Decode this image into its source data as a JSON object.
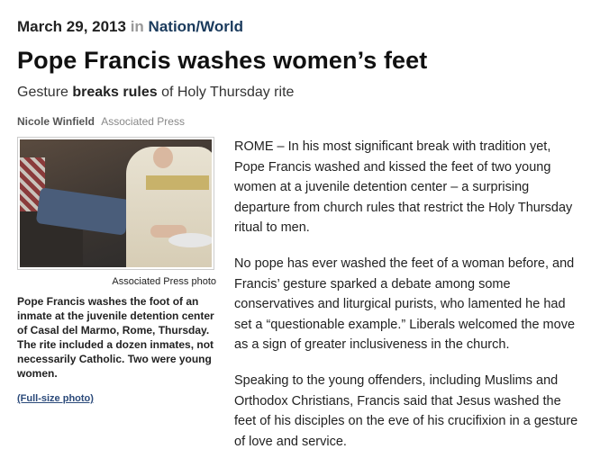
{
  "article": {
    "date": "March 29, 2013",
    "in_word": "in",
    "section": "Nation/World",
    "headline": "Pope Francis washes women’s feet",
    "deck": {
      "prefix": "Gesture ",
      "bold": "breaks rules",
      "suffix": " of Holy Thursday rite"
    },
    "byline": {
      "author": "Nicole Winfield",
      "agency": "Associated Press"
    },
    "photo": {
      "credit": "Associated Press photo",
      "caption": "Pope Francis washes the foot of an inmate at the juvenile detention center of Casal del Marmo, Rome, Thursday. The rite included a dozen inmates, not necessarily Catholic. Two were young women.",
      "full_size_link": "(Full-size photo)"
    },
    "paragraphs": [
      "ROME – In his most significant break with tradition yet, Pope Francis washed and kissed the feet of two young women at a juvenile detention center – a surprising departure from church rules that restrict the Holy Thursday ritual to men.",
      "No pope has ever washed the feet of a woman before, and Francis’ gesture sparked a debate among some conservatives and liturgical purists, who lamented he had set a “questionable example.” Liberals welcomed the move as a sign of greater inclusiveness in the church.",
      "Speaking to the young offenders, including Muslims and Orthodox Christians, Francis said that Jesus washed the feet of his disciples on the eve of his crucifixion in a gesture of love and service."
    ]
  }
}
